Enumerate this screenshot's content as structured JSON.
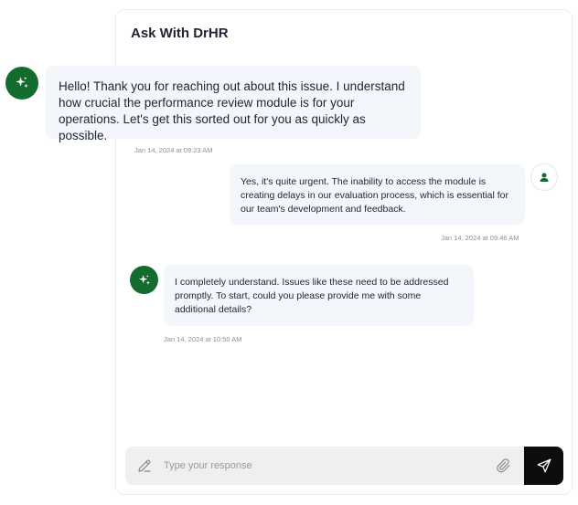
{
  "header": {
    "title": "Ask With DrHR"
  },
  "messages": [
    {
      "sender": "bot",
      "text": "Hello! Thank you for reaching out about this issue. I understand how crucial the performance review module is for your operations. Let's get this sorted out for you as quickly as possible.",
      "time": "Jan 14, 2024 at 09:23 AM"
    },
    {
      "sender": "user",
      "text": "Yes, it's quite urgent. The inability to access the module is creating delays in our evaluation process, which is essential for our team's development and feedback.",
      "time": "Jan 14, 2024 at 09:46 AM"
    },
    {
      "sender": "bot",
      "text": "I completely understand. Issues like these need to be addressed promptly. To start, could you please provide me with some additional details?",
      "time": "Jan 14, 2024 at 10:50 AM"
    }
  ],
  "composer": {
    "placeholder": "Type your response",
    "value": ""
  },
  "icons": {
    "bot_avatar": "sparkles-icon",
    "user_avatar": "user-icon",
    "pen": "pen-icon",
    "attach": "paperclip-icon",
    "send": "send-icon"
  },
  "colors": {
    "brand_green": "#146b2e",
    "bubble_bg": "#f3f7fb",
    "send_bg": "#0d0d0d",
    "composer_bg": "#efefef"
  }
}
